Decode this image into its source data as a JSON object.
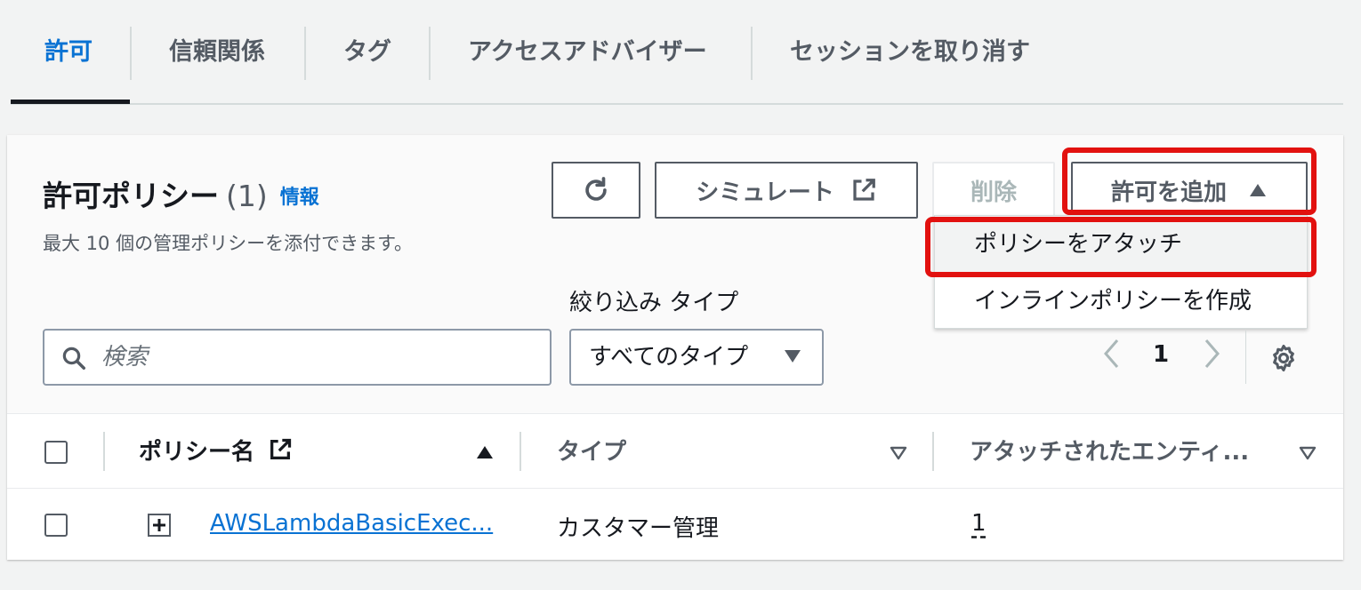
{
  "tabs": [
    {
      "label": "許可",
      "active": true
    },
    {
      "label": "信頼関係"
    },
    {
      "label": "タグ"
    },
    {
      "label": "アクセスアドバイザー"
    },
    {
      "label": "セッションを取り消す"
    }
  ],
  "panel": {
    "title": "許可ポリシー",
    "count": "(1)",
    "info_link": "情報",
    "description": "最大 10 個の管理ポリシーを添付できます。",
    "buttons": {
      "refresh_icon": "refresh-icon",
      "simulate": "シミュレート",
      "delete": "削除",
      "add_permissions": "許可を追加"
    },
    "dropdown": {
      "items": [
        "ポリシーをアタッチ",
        "インラインポリシーを作成"
      ]
    },
    "filter": {
      "label": "絞り込み タイプ",
      "search_placeholder": "検索",
      "type_selected": "すべてのタイプ"
    },
    "pagination": {
      "page": "1"
    }
  },
  "table": {
    "headers": [
      "ポリシー名",
      "タイプ",
      "アタッチされたエンティ..."
    ],
    "rows": [
      {
        "name": "AWSLambdaBasicExec...",
        "type": "カスタマー管理",
        "entities": "1"
      }
    ]
  },
  "colors": {
    "accent": "#0972d3",
    "highlight": "#e2110f"
  }
}
